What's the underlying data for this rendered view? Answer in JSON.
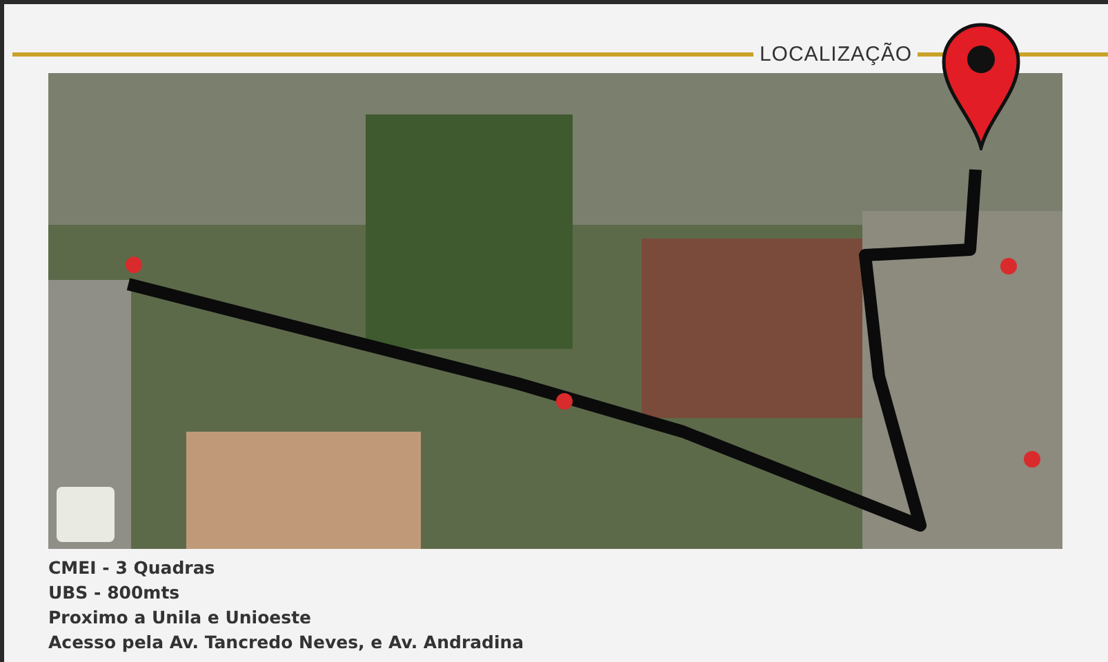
{
  "section": {
    "title": "LOCALIZAÇÃO"
  },
  "details": [
    "CMEI - 3 Quadras",
    "UBS - 800mts",
    "Proximo a Unila e Unioeste",
    "Acesso pela Av. Tancredo Neves, e Av. Andradina"
  ]
}
